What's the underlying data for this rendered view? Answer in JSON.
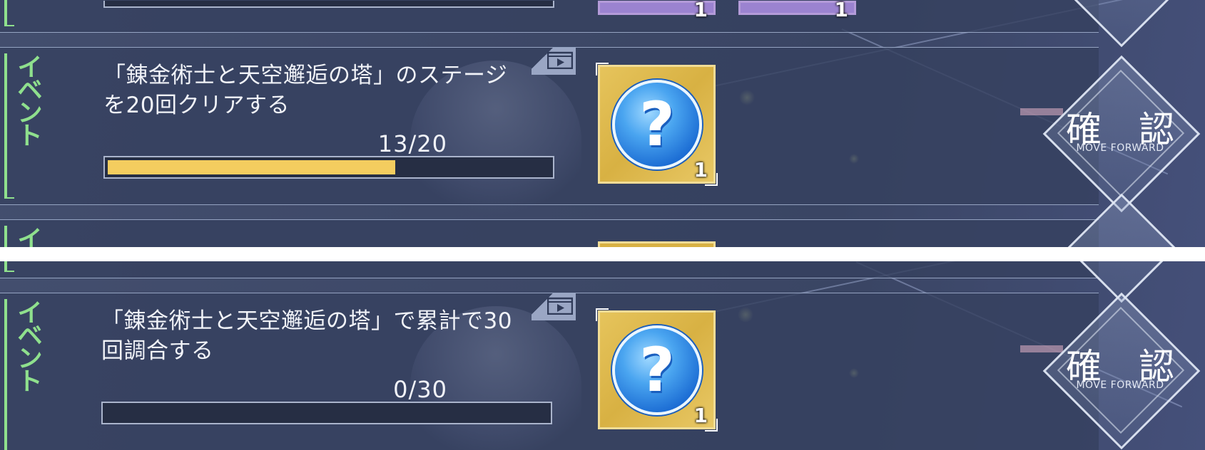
{
  "colors": {
    "accent_green": "#8fe08d",
    "progress_fill": "#f4cd5f",
    "progress_track": "#262e44",
    "row_background": "#36415f",
    "reward_gold": "#e6c45c",
    "orb_blue": "#1c6dd4"
  },
  "missions": [
    {
      "category": "イベント",
      "text_line1": "「錬金術士と天空邂逅の塔」のステージ",
      "text_line2": "を20回クリアする",
      "progress_text": "13/20",
      "progress_current": 13,
      "progress_goal": 20,
      "reward": {
        "icon": "mystery-orb-icon",
        "mark": "?",
        "count": "1"
      },
      "confirm_label": "確 認",
      "confirm_sub": "MOVE FORWARD",
      "has_video_icon": true
    },
    {
      "category": "イベント",
      "text_line1": "「錬金術士と天空邂逅の塔」で累計で30",
      "text_line2": "回調合する",
      "progress_text": "0/30",
      "progress_current": 0,
      "progress_goal": 30,
      "reward": {
        "icon": "mystery-orb-icon",
        "mark": "?",
        "count": "1"
      },
      "confirm_label": "確 認",
      "confirm_sub": "MOVE FORWARD",
      "has_video_icon": true
    }
  ],
  "partial_rows": {
    "top_previous_reward_counts": [
      "1",
      "1"
    ],
    "top_next_category": "イ"
  }
}
